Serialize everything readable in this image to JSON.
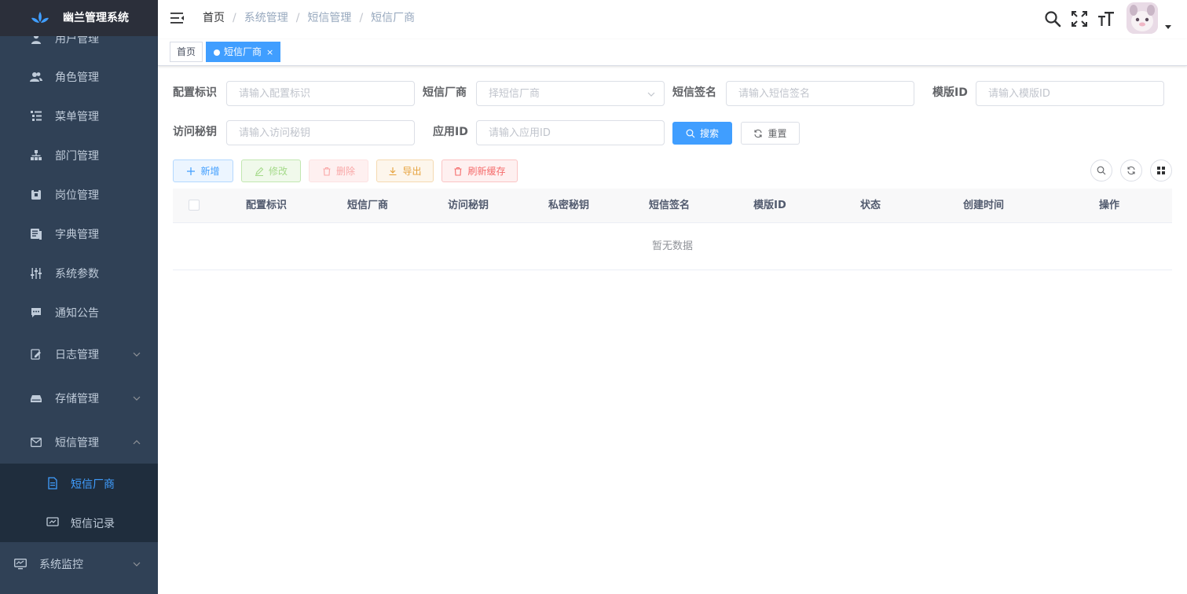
{
  "app": {
    "title": "幽兰管理系统"
  },
  "sidebar": {
    "items": [
      {
        "label": "用户管理",
        "icon": "user-icon"
      },
      {
        "label": "角色管理",
        "icon": "peoples-icon"
      },
      {
        "label": "菜单管理",
        "icon": "tree-table-icon"
      },
      {
        "label": "部门管理",
        "icon": "tree-icon"
      },
      {
        "label": "岗位管理",
        "icon": "post-icon"
      },
      {
        "label": "字典管理",
        "icon": "dict-icon"
      },
      {
        "label": "系统参数",
        "icon": "edit-icon"
      },
      {
        "label": "通知公告",
        "icon": "message-icon"
      },
      {
        "label": "日志管理",
        "icon": "log-icon"
      },
      {
        "label": "存储管理",
        "icon": "storage-icon"
      },
      {
        "label": "短信管理",
        "icon": "email-icon"
      }
    ],
    "submenu": [
      {
        "label": "短信厂商",
        "icon": "documentation-icon"
      },
      {
        "label": "短信记录",
        "icon": "record-icon"
      }
    ],
    "bottom": {
      "label": "系统监控",
      "icon": "monitor-icon"
    }
  },
  "breadcrumb": [
    "首页",
    "系统管理",
    "短信管理",
    "短信厂商"
  ],
  "tags": {
    "home": "首页",
    "active": "短信厂商",
    "close": "×"
  },
  "search_form": {
    "config_key": {
      "label": "配置标识",
      "placeholder": "请输入配置标识"
    },
    "supplier": {
      "label": "短信厂商",
      "placeholder": "择短信厂商"
    },
    "signature": {
      "label": "短信签名",
      "placeholder": "请输入短信签名"
    },
    "template_id": {
      "label": "模版ID",
      "placeholder": "请输入模版ID"
    },
    "access_key": {
      "label": "访问秘钥",
      "placeholder": "请输入访问秘钥"
    },
    "app_id": {
      "label": "应用ID",
      "placeholder": "请输入应用ID"
    },
    "search_button": "搜索",
    "reset_button": "重置"
  },
  "toolbar": {
    "add": "新增",
    "edit": "修改",
    "delete": "删除",
    "export": "导出",
    "refresh_cache": "刷新缓存"
  },
  "table": {
    "columns": [
      "配置标识",
      "短信厂商",
      "访问秘钥",
      "私密秘钥",
      "短信签名",
      "模版ID",
      "状态",
      "创建时间",
      "操作"
    ],
    "empty_text": "暂无数据"
  },
  "colors": {
    "primary": "#409eff",
    "sidebar_bg": "#304156",
    "logo_bg": "#2b2f3a"
  }
}
